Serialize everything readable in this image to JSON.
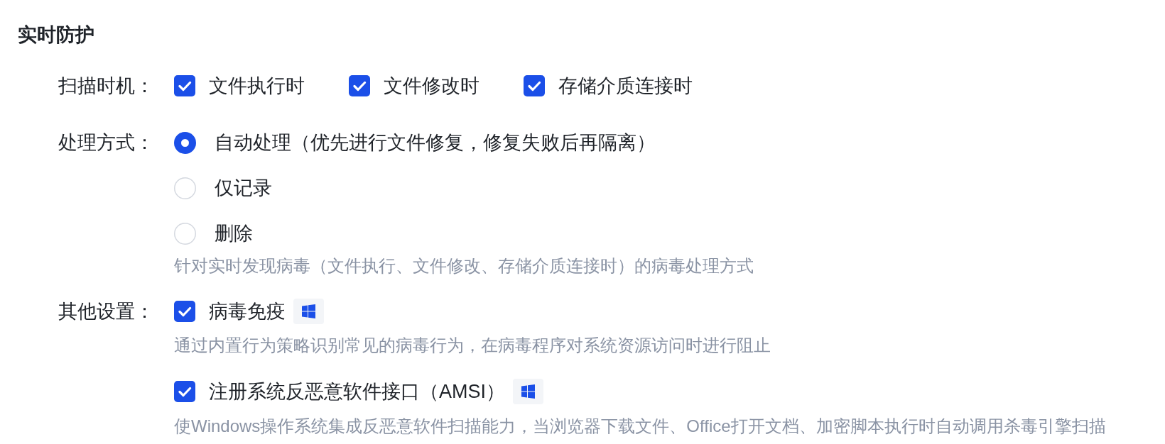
{
  "section": {
    "title": "实时防护"
  },
  "fields": [
    {
      "kind": "checkbox-row",
      "label": "扫描时机：",
      "options": [
        {
          "label": "文件执行时",
          "checked": true
        },
        {
          "label": "文件修改时",
          "checked": true
        },
        {
          "label": "存储介质连接时",
          "checked": true
        }
      ]
    },
    {
      "kind": "radio-group",
      "label": "处理方式：",
      "options": [
        {
          "label": "自动处理（优先进行文件修复，修复失败后再隔离）",
          "selected": true
        },
        {
          "label": "仅记录",
          "selected": false
        },
        {
          "label": "删除",
          "selected": false
        }
      ],
      "hint": "针对实时发现病毒（文件执行、文件修改、存储介质连接时）的病毒处理方式"
    },
    {
      "kind": "checkbox-list",
      "label": "其他设置：",
      "options": [
        {
          "label": "病毒免疫",
          "checked": true,
          "hint": "通过内置行为策略识别常见的病毒行为，在病毒程序对系统资源访问时进行阻止"
        },
        {
          "label": "注册系统反恶意软件接口（AMSI）",
          "checked": true,
          "hint": "使Windows操作系统集成反恶意软件扫描能力，当浏览器下载文件、Office打开文档、加密脚本执行时自动调用杀毒引擎扫描"
        }
      ]
    }
  ]
}
